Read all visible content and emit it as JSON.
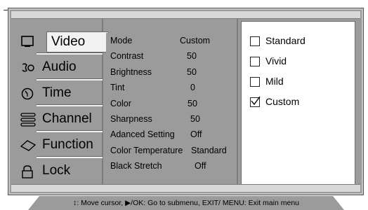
{
  "menu": {
    "items": [
      {
        "label": "Video",
        "icon": "monitor-icon"
      },
      {
        "label": "Audio",
        "icon": "speaker-icon"
      },
      {
        "label": "Time",
        "icon": "clock-icon"
      },
      {
        "label": "Channel",
        "icon": "channel-icon"
      },
      {
        "label": "Function",
        "icon": "function-icon"
      },
      {
        "label": "Lock",
        "icon": "lock-icon"
      }
    ],
    "active_index": 0
  },
  "settings": {
    "rows": [
      {
        "name": "Mode",
        "value": "Custom"
      },
      {
        "name": "Contrast",
        "value": "50"
      },
      {
        "name": "Brightness",
        "value": "50"
      },
      {
        "name": "Tint",
        "value": "0"
      },
      {
        "name": "Color",
        "value": "50"
      },
      {
        "name": "Sharpness",
        "value": "50"
      },
      {
        "name": "Adanced Setting",
        "value": "Off"
      },
      {
        "name": "Color Temperature",
        "value": "Standard"
      },
      {
        "name": "Black Stretch",
        "value": "Off"
      }
    ]
  },
  "options": {
    "items": [
      {
        "label": "Standard",
        "checked": false
      },
      {
        "label": "Vivid",
        "checked": false
      },
      {
        "label": "Mild",
        "checked": false
      },
      {
        "label": "Custom",
        "checked": true
      }
    ]
  },
  "help": {
    "text": "↕: Move cursor,  ▶/OK: Go to submenu, EXIT/ MENU: Exit main menu"
  },
  "colors": {
    "panel": "#9b9b9b",
    "highlight": "#f2f2f2",
    "border": "#6a6a6a"
  }
}
